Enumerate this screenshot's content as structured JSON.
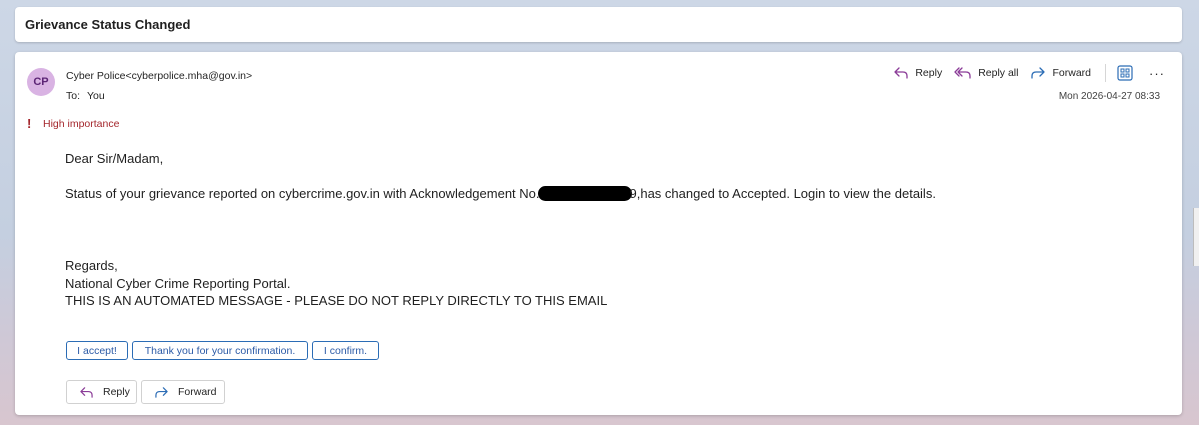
{
  "subject": "Grievance Status Changed",
  "sender": {
    "initials": "CP",
    "display": "Cyber Police<cyberpolice.mha@gov.in>"
  },
  "recipient": {
    "label": "To:",
    "value": "You"
  },
  "date": "Mon 2026-04-27 08:33",
  "importance": {
    "icon": "!",
    "label": "High importance"
  },
  "toolbar": {
    "reply": "Reply",
    "reply_all": "Reply all",
    "forward": "Forward",
    "more": "···"
  },
  "body": {
    "greeting": "Dear Sir/Madam,",
    "status_before": "Status of your grievance reported on cybercrime.gov.in with Acknowledgement No.",
    "status_after": "9,has changed to Accepted. Login to view the details.",
    "regards": "Regards,",
    "portal": "National Cyber Crime Reporting Portal.",
    "automated": "THIS IS AN AUTOMATED MESSAGE - PLEASE DO NOT REPLY DIRECTLY TO THIS EMAIL"
  },
  "suggested_replies": [
    "I accept!",
    "Thank you for your confirmation.",
    "I confirm."
  ],
  "footer": {
    "reply": "Reply",
    "forward": "Forward"
  },
  "colors": {
    "accent": "#2b6cb5",
    "importance": "#a4262c",
    "avatar_bg": "#d9b3e3",
    "reply_icon": "#8a3b97",
    "forward_icon": "#2b6cb5"
  }
}
